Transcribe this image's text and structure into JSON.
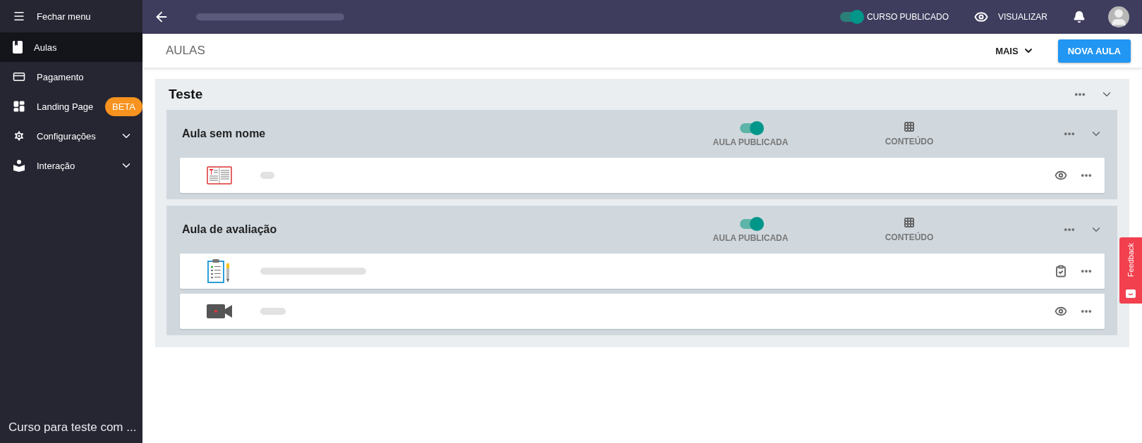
{
  "sidebar": {
    "close_label": "Fechar menu",
    "items": [
      {
        "kind": "lessons",
        "label": "Aulas",
        "selected": true
      },
      {
        "kind": "payment",
        "label": "Pagamento",
        "selected": false
      },
      {
        "kind": "landing",
        "label": "Landing Page",
        "selected": false,
        "badge": "BETA"
      },
      {
        "kind": "settings",
        "label": "Configurações",
        "selected": false,
        "expanded": false
      },
      {
        "kind": "interaction",
        "label": "Interação",
        "selected": false,
        "expanded": false
      }
    ],
    "footer": "Curso para teste com ..."
  },
  "topbar": {
    "published": {
      "label": "CURSO PUBLICADO",
      "on": true
    },
    "preview": "VISUALIZAR"
  },
  "toolbar": {
    "title": "AULAS",
    "more": "MAIS",
    "new_button": "NOVA AULA"
  },
  "module": {
    "title": "Teste",
    "expanded": true,
    "lessons": [
      {
        "title": "Aula sem nome",
        "published": true,
        "published_label": "AULA PUBLICADA",
        "content_label": "CONTEÚDO",
        "expanded": true,
        "items": [
          {
            "kind": "pdf",
            "action": {
              "kind": "preview"
            }
          }
        ]
      },
      {
        "title": "Aula de avaliação",
        "published": true,
        "published_label": "AULA PUBLICADA",
        "content_label": "CONTEÚDO",
        "expanded": true,
        "items": [
          {
            "kind": "survey",
            "action": {
              "kind": "check"
            }
          },
          {
            "kind": "video",
            "action": {
              "kind": "preview"
            }
          }
        ]
      }
    ]
  },
  "feedback": "Feedback"
}
